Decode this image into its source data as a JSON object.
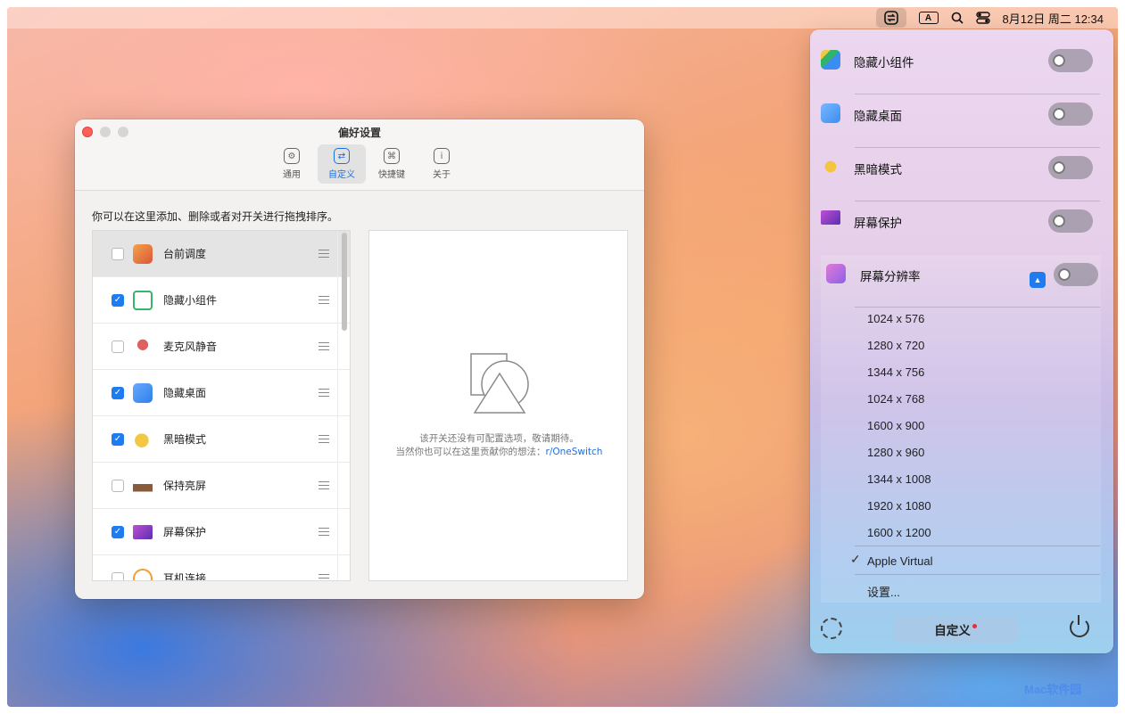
{
  "menubar": {
    "input_indicator": "A",
    "datetime": "8月12日 周二  12:34"
  },
  "prefs": {
    "title": "偏好设置",
    "tabs": [
      {
        "label": "通用",
        "icon": "gear-icon"
      },
      {
        "label": "自定义",
        "icon": "switch-icon"
      },
      {
        "label": "快捷键",
        "icon": "command-icon"
      },
      {
        "label": "关于",
        "icon": "info-icon"
      }
    ],
    "description": "你可以在这里添加、删除或者对开关进行拖拽排序。",
    "items": [
      {
        "label": "台前调度",
        "checked": false,
        "color": "#d9573c"
      },
      {
        "label": "隐藏小组件",
        "checked": true,
        "color": "#39b56a"
      },
      {
        "label": "麦克风静音",
        "checked": false,
        "color": "#d24a4a"
      },
      {
        "label": "隐藏桌面",
        "checked": true,
        "color": "#3b8ef0"
      },
      {
        "label": "黑暗模式",
        "checked": true,
        "color": "#f2c744"
      },
      {
        "label": "保持亮屏",
        "checked": false,
        "color": "#8a5a3c"
      },
      {
        "label": "屏幕保护",
        "checked": true,
        "color": "#8b3aa6"
      },
      {
        "label": "耳机连接",
        "checked": false,
        "color": "#f0a030"
      }
    ],
    "detail": {
      "line1": "该开关还没有可配置选项，敬请期待。",
      "line2": "当然你也可以在这里贡献你的想法：",
      "link": "r/OneSwitch"
    }
  },
  "panel": {
    "toggles": [
      {
        "label": "隐藏小组件",
        "icon_color": "#2fb46c"
      },
      {
        "label": "隐藏桌面",
        "icon_color": "#3b8ef0"
      },
      {
        "label": "黑暗模式",
        "icon_color": "#f5c542"
      },
      {
        "label": "屏幕保护",
        "icon_color": "#8b3aa6"
      },
      {
        "label": "屏幕分辨率",
        "icon_color": "#a66be0"
      }
    ],
    "resolutions": [
      "1024 x 576",
      "1280 x 720",
      "1344 x 756",
      "1024 x 768",
      "1600 x 900",
      "1280 x 960",
      "1344 x 1008",
      "1920 x 1080",
      "1600 x 1200"
    ],
    "selected_display": "Apple Virtual",
    "settings_label": "设置...",
    "customize_label": "自定义"
  },
  "watermark": "Mac软件园"
}
